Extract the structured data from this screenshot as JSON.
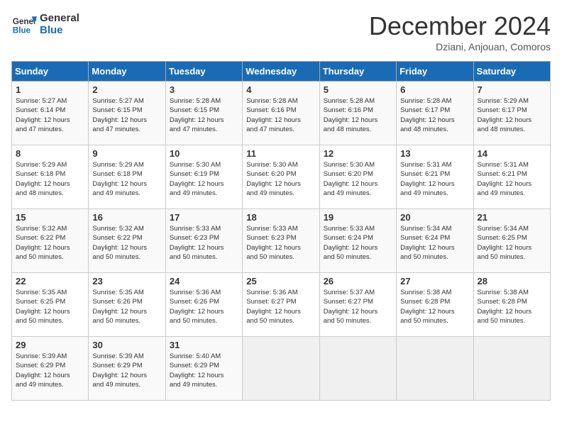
{
  "logo": {
    "line1": "General",
    "line2": "Blue"
  },
  "title": "December 2024",
  "subtitle": "Dziani, Anjouan, Comoros",
  "days_of_week": [
    "Sunday",
    "Monday",
    "Tuesday",
    "Wednesday",
    "Thursday",
    "Friday",
    "Saturday"
  ],
  "weeks": [
    [
      {
        "day": 1,
        "info": "Sunrise: 5:27 AM\nSunset: 6:14 PM\nDaylight: 12 hours\nand 47 minutes."
      },
      {
        "day": 2,
        "info": "Sunrise: 5:27 AM\nSunset: 6:15 PM\nDaylight: 12 hours\nand 47 minutes."
      },
      {
        "day": 3,
        "info": "Sunrise: 5:28 AM\nSunset: 6:15 PM\nDaylight: 12 hours\nand 47 minutes."
      },
      {
        "day": 4,
        "info": "Sunrise: 5:28 AM\nSunset: 6:16 PM\nDaylight: 12 hours\nand 47 minutes."
      },
      {
        "day": 5,
        "info": "Sunrise: 5:28 AM\nSunset: 6:16 PM\nDaylight: 12 hours\nand 48 minutes."
      },
      {
        "day": 6,
        "info": "Sunrise: 5:28 AM\nSunset: 6:17 PM\nDaylight: 12 hours\nand 48 minutes."
      },
      {
        "day": 7,
        "info": "Sunrise: 5:29 AM\nSunset: 6:17 PM\nDaylight: 12 hours\nand 48 minutes."
      }
    ],
    [
      {
        "day": 8,
        "info": "Sunrise: 5:29 AM\nSunset: 6:18 PM\nDaylight: 12 hours\nand 48 minutes."
      },
      {
        "day": 9,
        "info": "Sunrise: 5:29 AM\nSunset: 6:18 PM\nDaylight: 12 hours\nand 49 minutes."
      },
      {
        "day": 10,
        "info": "Sunrise: 5:30 AM\nSunset: 6:19 PM\nDaylight: 12 hours\nand 49 minutes."
      },
      {
        "day": 11,
        "info": "Sunrise: 5:30 AM\nSunset: 6:20 PM\nDaylight: 12 hours\nand 49 minutes."
      },
      {
        "day": 12,
        "info": "Sunrise: 5:30 AM\nSunset: 6:20 PM\nDaylight: 12 hours\nand 49 minutes."
      },
      {
        "day": 13,
        "info": "Sunrise: 5:31 AM\nSunset: 6:21 PM\nDaylight: 12 hours\nand 49 minutes."
      },
      {
        "day": 14,
        "info": "Sunrise: 5:31 AM\nSunset: 6:21 PM\nDaylight: 12 hours\nand 49 minutes."
      }
    ],
    [
      {
        "day": 15,
        "info": "Sunrise: 5:32 AM\nSunset: 6:22 PM\nDaylight: 12 hours\nand 50 minutes."
      },
      {
        "day": 16,
        "info": "Sunrise: 5:32 AM\nSunset: 6:22 PM\nDaylight: 12 hours\nand 50 minutes."
      },
      {
        "day": 17,
        "info": "Sunrise: 5:33 AM\nSunset: 6:23 PM\nDaylight: 12 hours\nand 50 minutes."
      },
      {
        "day": 18,
        "info": "Sunrise: 5:33 AM\nSunset: 6:23 PM\nDaylight: 12 hours\nand 50 minutes."
      },
      {
        "day": 19,
        "info": "Sunrise: 5:33 AM\nSunset: 6:24 PM\nDaylight: 12 hours\nand 50 minutes."
      },
      {
        "day": 20,
        "info": "Sunrise: 5:34 AM\nSunset: 6:24 PM\nDaylight: 12 hours\nand 50 minutes."
      },
      {
        "day": 21,
        "info": "Sunrise: 5:34 AM\nSunset: 6:25 PM\nDaylight: 12 hours\nand 50 minutes."
      }
    ],
    [
      {
        "day": 22,
        "info": "Sunrise: 5:35 AM\nSunset: 6:25 PM\nDaylight: 12 hours\nand 50 minutes."
      },
      {
        "day": 23,
        "info": "Sunrise: 5:35 AM\nSunset: 6:26 PM\nDaylight: 12 hours\nand 50 minutes."
      },
      {
        "day": 24,
        "info": "Sunrise: 5:36 AM\nSunset: 6:26 PM\nDaylight: 12 hours\nand 50 minutes."
      },
      {
        "day": 25,
        "info": "Sunrise: 5:36 AM\nSunset: 6:27 PM\nDaylight: 12 hours\nand 50 minutes."
      },
      {
        "day": 26,
        "info": "Sunrise: 5:37 AM\nSunset: 6:27 PM\nDaylight: 12 hours\nand 50 minutes."
      },
      {
        "day": 27,
        "info": "Sunrise: 5:38 AM\nSunset: 6:28 PM\nDaylight: 12 hours\nand 50 minutes."
      },
      {
        "day": 28,
        "info": "Sunrise: 5:38 AM\nSunset: 6:28 PM\nDaylight: 12 hours\nand 50 minutes."
      }
    ],
    [
      {
        "day": 29,
        "info": "Sunrise: 5:39 AM\nSunset: 6:29 PM\nDaylight: 12 hours\nand 49 minutes."
      },
      {
        "day": 30,
        "info": "Sunrise: 5:39 AM\nSunset: 6:29 PM\nDaylight: 12 hours\nand 49 minutes."
      },
      {
        "day": 31,
        "info": "Sunrise: 5:40 AM\nSunset: 6:29 PM\nDaylight: 12 hours\nand 49 minutes."
      },
      null,
      null,
      null,
      null
    ]
  ]
}
